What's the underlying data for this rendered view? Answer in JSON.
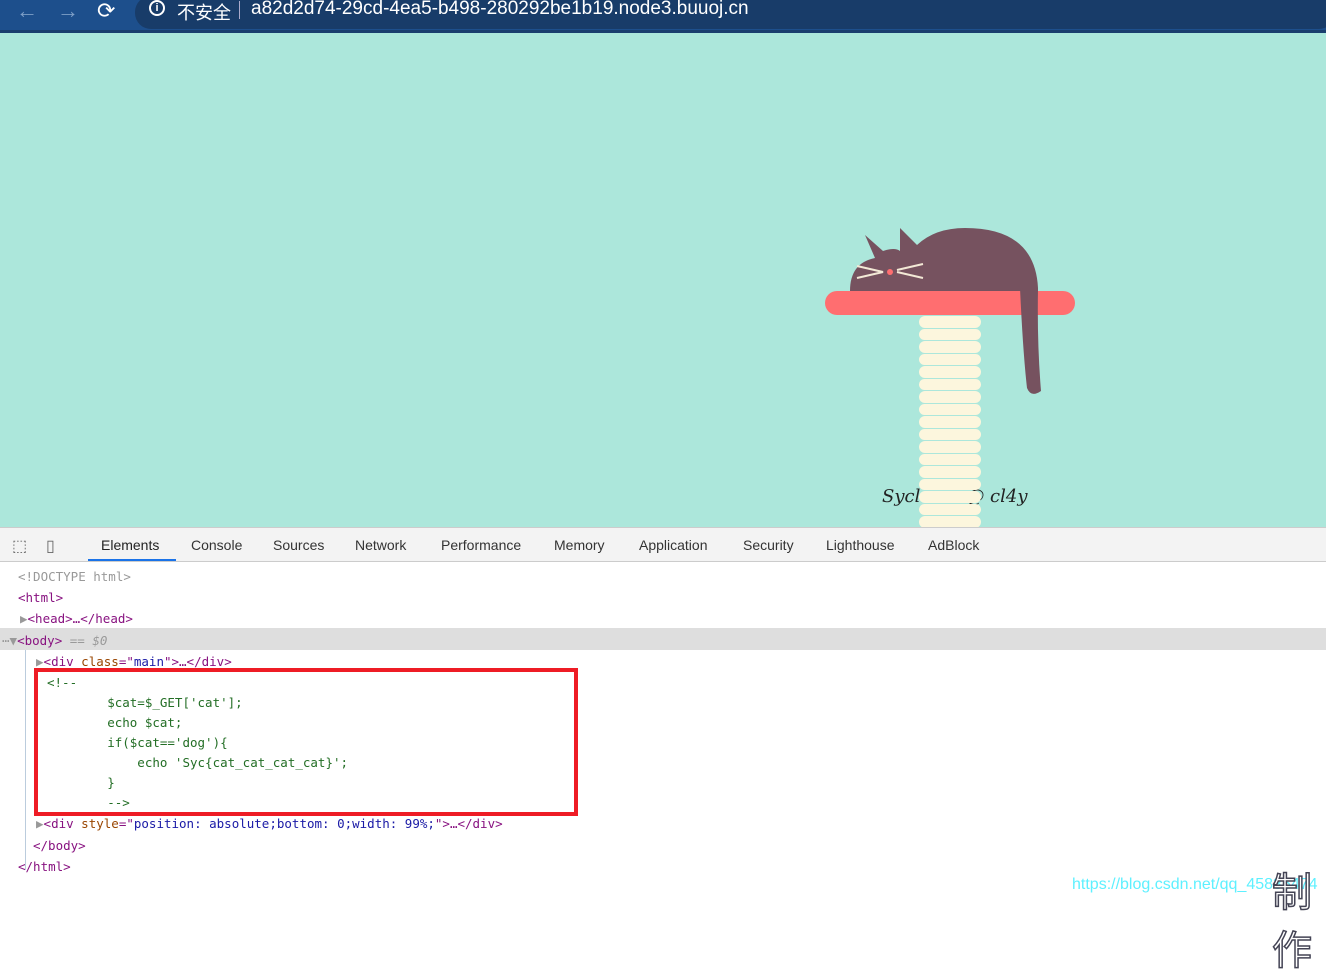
{
  "browser": {
    "insecure_label": "不安全",
    "url": "a82d2d74-29cd-4ea5-b498-280292be1b19.node3.buuoj.cn"
  },
  "page": {
    "signature": "Syclover @ cl4y",
    "colors": {
      "background": "#ace7db",
      "platform": "#ff6e70",
      "cat": "#76525f",
      "post": "#fcf6dd"
    }
  },
  "devtools": {
    "tabs": [
      "Elements",
      "Console",
      "Sources",
      "Network",
      "Performance",
      "Memory",
      "Application",
      "Security",
      "Lighthouse",
      "AdBlock"
    ],
    "active_tab": "Elements",
    "dom": {
      "doctype": "<!DOCTYPE html>",
      "html_open": "<html>",
      "head": "<head>…</head>",
      "body_open": "<body>",
      "body_ref": " == $0",
      "div_main": {
        "tag": "div",
        "attr": "class",
        "value": "main"
      },
      "comment": [
        "<!--",
        "        $cat=$_GET['cat'];",
        "        echo $cat;",
        "        if($cat=='dog'){",
        "            echo 'Syc{cat_cat_cat_cat}';",
        "        }",
        "        -->"
      ],
      "div_style": {
        "tag": "div",
        "attr": "style",
        "value": "position: absolute;bottom: 0;width: 99%;"
      },
      "body_close": "</body>",
      "html_close": "</html>"
    }
  },
  "watermark": {
    "url": "https://blog.csdn.net/qq_45836474",
    "stamp": "制作"
  }
}
